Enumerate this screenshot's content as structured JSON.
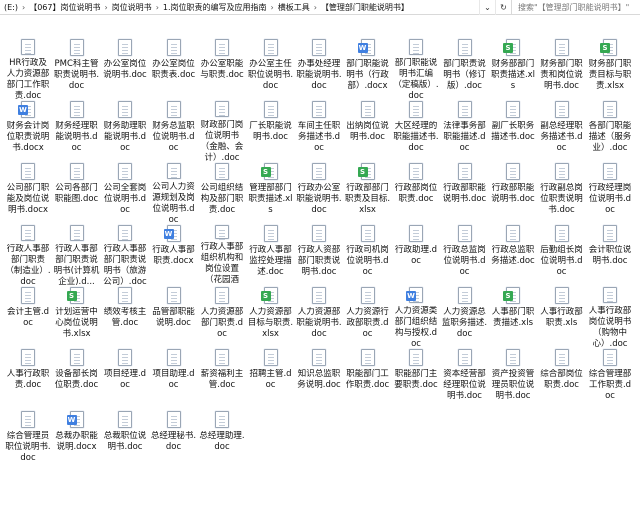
{
  "address_bar": {
    "drive": "(E:)",
    "crumbs": [
      "【067】岗位说明书",
      "岗位说明书",
      "1.岗位职责的编写及应用指南",
      "横板工具",
      "【管理部门职能说明书】"
    ],
    "search_placeholder": "搜索\"【管理部门职能说明书】\""
  },
  "files": [
    {
      "name": "HR行政及人力资源部部门工作职责.doc",
      "type": "plain"
    },
    {
      "name": "PMC科主管职责说明书.doc",
      "type": "plain"
    },
    {
      "name": "办公室岗位说明书.doc",
      "type": "plain"
    },
    {
      "name": "办公室岗位职责表.doc",
      "type": "plain"
    },
    {
      "name": "办公室职能与职责.doc",
      "type": "plain"
    },
    {
      "name": "办公室主任职位说明书.doc",
      "type": "plain"
    },
    {
      "name": "办事处经理职能说明书.doc",
      "type": "plain"
    },
    {
      "name": "部门职能说明书（行政部）.docx",
      "type": "word"
    },
    {
      "name": "部门职能说明书汇编（定稿版）.doc",
      "type": "plain"
    },
    {
      "name": "部门职责说明书（修订版）.doc",
      "type": "plain"
    },
    {
      "name": "财务部部门职责描述.xls",
      "type": "excel"
    },
    {
      "name": "财务部门职责和岗位说明书.doc",
      "type": "plain"
    },
    {
      "name": "财务部门职责目标与职责.xlsx",
      "type": "excel"
    },
    {
      "name": "财务会计岗位职责说明书.docx",
      "type": "word"
    },
    {
      "name": "财务经理职能说明书.doc",
      "type": "plain"
    },
    {
      "name": "财务助理职能说明书.doc",
      "type": "plain"
    },
    {
      "name": "财务总监职位说明书.doc",
      "type": "plain"
    },
    {
      "name": "财政部门岗位说明书（金融、会计）.doc",
      "type": "plain"
    },
    {
      "name": "厂长职能说明书.doc",
      "type": "plain"
    },
    {
      "name": "车间主任职务描述书.doc",
      "type": "plain"
    },
    {
      "name": "出纳岗位说明书.doc",
      "type": "plain"
    },
    {
      "name": "大区经理的职能描述书.doc",
      "type": "plain"
    },
    {
      "name": "法律事务部职能描述.doc",
      "type": "plain"
    },
    {
      "name": "副厂长职务描述书.doc",
      "type": "plain"
    },
    {
      "name": "副总经理职务描述书.doc",
      "type": "plain"
    },
    {
      "name": "各部门职能描述（服务业）.doc",
      "type": "plain"
    },
    {
      "name": "公司部门职能及岗位说明书.docx",
      "type": "plain"
    },
    {
      "name": "公司各部门职能图.doc",
      "type": "plain"
    },
    {
      "name": "公司全套岗位说明书.doc",
      "type": "plain"
    },
    {
      "name": "公司人力资源规划及岗位说明书.doc",
      "type": "plain"
    },
    {
      "name": "公司组织结构及部门职责.doc",
      "type": "plain"
    },
    {
      "name": "管理部部门职责描述.xls",
      "type": "excel"
    },
    {
      "name": "行政办公室职能说明书.doc",
      "type": "plain"
    },
    {
      "name": "行政部部门职责及目标.xlsx",
      "type": "excel"
    },
    {
      "name": "行政部岗位职责.doc",
      "type": "plain"
    },
    {
      "name": "行政部职能说明书.doc",
      "type": "plain"
    },
    {
      "name": "行政部职能说明书.doc",
      "type": "plain"
    },
    {
      "name": "行政副总岗位职责说明书.doc",
      "type": "plain"
    },
    {
      "name": "行政经理岗位说明书.doc",
      "type": "plain"
    },
    {
      "name": "行政人事部部门职责（制造业）.doc",
      "type": "plain"
    },
    {
      "name": "行政人事部部门职责说明书(计算机企业).d...",
      "type": "plain"
    },
    {
      "name": "行政人事部部门职责说明书（旅游公司）.doc",
      "type": "plain"
    },
    {
      "name": "行政人事部职责.docx",
      "type": "word"
    },
    {
      "name": "行政人事部组织机构和岗位设置（花园酒店...",
      "type": "plain"
    },
    {
      "name": "行政人事部监控处理描述.doc",
      "type": "plain"
    },
    {
      "name": "行政人资部部门职责说明书.doc",
      "type": "plain"
    },
    {
      "name": "行政司机岗位说明书.doc",
      "type": "plain"
    },
    {
      "name": "行政助理.doc",
      "type": "plain"
    },
    {
      "name": "行政总监岗位说明书.doc",
      "type": "plain"
    },
    {
      "name": "行政总监职务描述.doc",
      "type": "plain"
    },
    {
      "name": "后勤组长岗位说明书.doc",
      "type": "plain"
    },
    {
      "name": "会计职位说明书.doc",
      "type": "plain"
    },
    {
      "name": "会计主管.doc",
      "type": "plain"
    },
    {
      "name": "计划运营中心岗位说明书.xlsx",
      "type": "excel"
    },
    {
      "name": "绩效考核主管.doc",
      "type": "plain"
    },
    {
      "name": "品管部职能说明.doc",
      "type": "plain"
    },
    {
      "name": "人力资源部部门职责.doc",
      "type": "plain"
    },
    {
      "name": "人力资源部目标与职责.xlsx",
      "type": "excel"
    },
    {
      "name": "人力资源部职能说明书.doc",
      "type": "plain"
    },
    {
      "name": "人力资源行政部职责.doc",
      "type": "plain"
    },
    {
      "name": "人力资源类部门组织结构与授权.doc",
      "type": "word"
    },
    {
      "name": "人力资源总监职务描述.doc",
      "type": "plain"
    },
    {
      "name": "人事部门职责描述.xls",
      "type": "excel"
    },
    {
      "name": "人事行政部职责.xls",
      "type": "plain"
    },
    {
      "name": "人事行政部岗位说明书（购物中心）.doc",
      "type": "plain"
    },
    {
      "name": "人事行政职责.doc",
      "type": "plain"
    },
    {
      "name": "设备部长岗位职责.doc",
      "type": "plain"
    },
    {
      "name": "项目经理.doc",
      "type": "plain"
    },
    {
      "name": "项目助理.doc",
      "type": "plain"
    },
    {
      "name": "薪资福利主管.doc",
      "type": "plain"
    },
    {
      "name": "招聘主管.doc",
      "type": "plain"
    },
    {
      "name": "知识总监职务说明.doc",
      "type": "plain"
    },
    {
      "name": "职能部门工作职责.doc",
      "type": "plain"
    },
    {
      "name": "职能部门主要职责.doc",
      "type": "plain"
    },
    {
      "name": "资本经营部经理职位说明书.doc",
      "type": "plain"
    },
    {
      "name": "资产投资管理员职位说明书.doc",
      "type": "plain"
    },
    {
      "name": "综合部岗位职责.doc",
      "type": "plain"
    },
    {
      "name": "综合管理部工作职责.doc",
      "type": "plain"
    },
    {
      "name": "综合管理员职位说明书.doc",
      "type": "plain"
    },
    {
      "name": "总裁办职能说明.docx",
      "type": "word"
    },
    {
      "name": "总裁职位说明书.doc",
      "type": "plain"
    },
    {
      "name": "总经理秘书.doc",
      "type": "plain"
    },
    {
      "name": "总经理助理.doc",
      "type": "plain"
    }
  ],
  "colors": {
    "word_badge": "#3f7fe0",
    "excel_badge": "#35a852"
  }
}
